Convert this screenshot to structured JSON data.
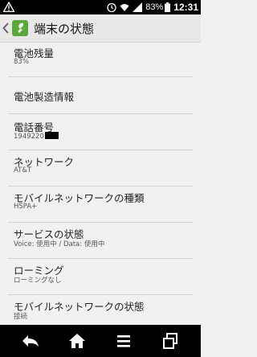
{
  "status_bar": {
    "battery_percent": "83%",
    "time": "12:31",
    "icons": [
      "warning-icon",
      "alarm-icon",
      "wifi-icon",
      "signal-icon",
      "battery-icon"
    ]
  },
  "action_bar": {
    "title": "端末の状態"
  },
  "items": [
    {
      "title": "電池残量",
      "summary": "83%"
    },
    {
      "title": "電池製造情報"
    },
    {
      "title": "電話番号",
      "summary": "1949220"
    },
    {
      "title": "ネットワーク",
      "summary": "AT&T"
    },
    {
      "title": "モバイルネットワークの種類",
      "summary": "HSPA+"
    },
    {
      "title": "サービスの状態",
      "summary": "Voice: 使用中 / Data: 使用中"
    },
    {
      "title": "ローミング",
      "summary": "ローミングなし"
    },
    {
      "title": "モバイルネットワークの状態",
      "summary": "接続"
    }
  ],
  "nav_bar": {
    "buttons": [
      "back-icon",
      "home-icon",
      "menu-icon",
      "recent-apps-icon"
    ]
  }
}
